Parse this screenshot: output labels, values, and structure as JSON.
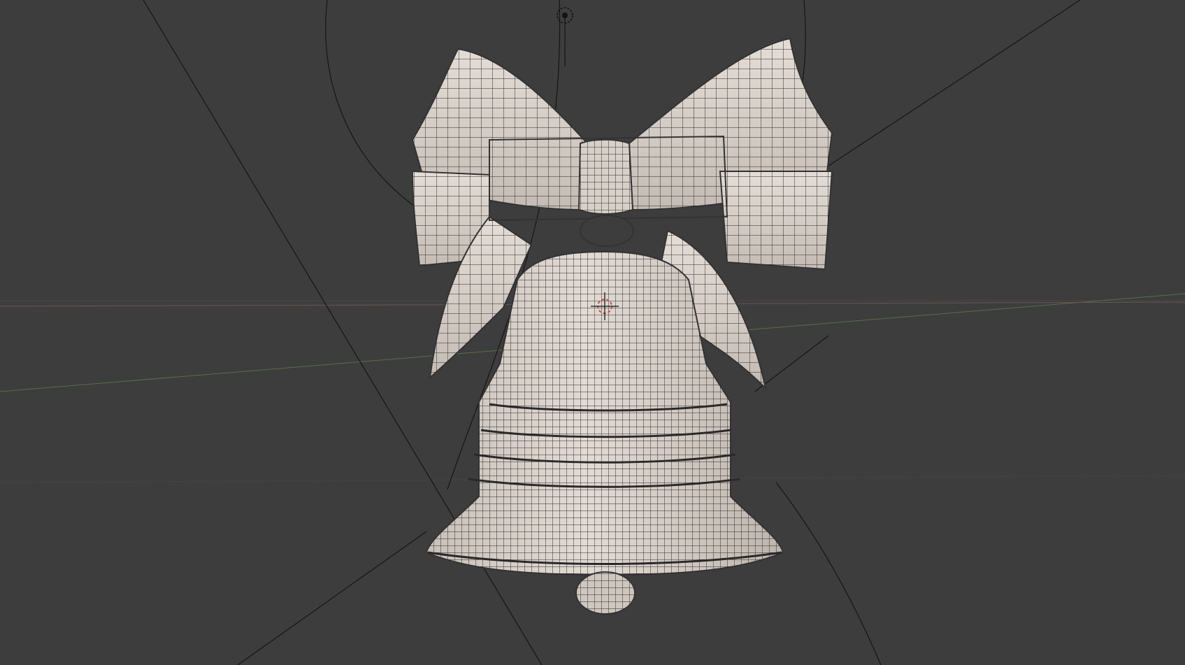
{
  "viewport": {
    "background_color": "#3d3d3d",
    "mesh_color": "#dcd5ce",
    "wire_color": "#222222",
    "grid_line_color": "#4a4a4a",
    "x_axis_color": "#6e5454",
    "y_axis_color": "#5a6e4a",
    "camera_guide_color": "#111111",
    "scene_object": "bell-with-bow",
    "shading_mode": "solid-wireframe"
  }
}
